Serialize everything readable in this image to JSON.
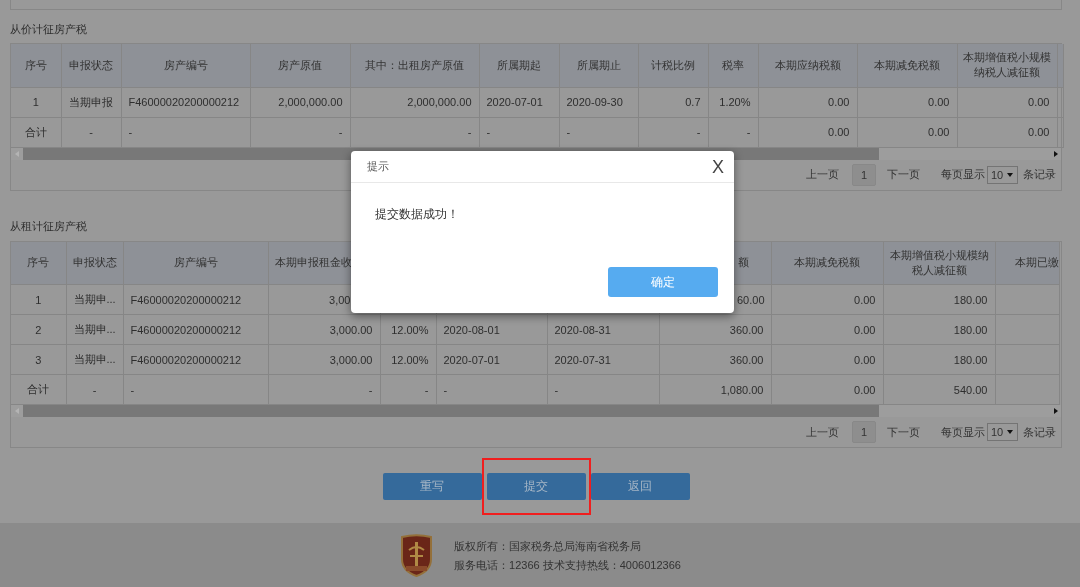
{
  "sections": [
    {
      "title": "从价计征房产税",
      "table": {
        "columns": [
          "序号",
          "申报状态",
          "房产编号",
          "房产原值",
          "其中：出租房产原值",
          "所属期起",
          "所属期止",
          "计税比例",
          "税率",
          "本期应纳税额",
          "本期减免税额",
          "本期增值税小规模纳税人减征额"
        ],
        "rows": [
          [
            "1",
            "当期申报",
            "F46000020200000212",
            "2,000,000.00",
            "2,000,000.00",
            "2020-07-01",
            "2020-09-30",
            "0.7",
            "1.20%",
            "0.00",
            "0.00",
            "0.00"
          ],
          [
            "合计",
            "-",
            "-",
            "-",
            "-",
            "-",
            "-",
            "-",
            "-",
            "0.00",
            "0.00",
            "0.00"
          ]
        ]
      },
      "pagination": {
        "prev": "上一页",
        "page": "1",
        "next": "下一页",
        "size_label": "每页显示",
        "size": "10",
        "size_suffix": "条记录"
      }
    },
    {
      "title": "从租计征房产税",
      "table": {
        "columns": [
          "序号",
          "申报状态",
          "房产编号",
          "本期申报租金收",
          null,
          null,
          null,
          "额",
          "本期减免税额",
          "本期增值税小规模纳税人减征额",
          "本期已缴"
        ],
        "rows": [
          [
            "1",
            "当期申...",
            "F46000020200000212",
            "3,00",
            null,
            null,
            null,
            "60.00",
            "0.00",
            "180.00"
          ],
          [
            "2",
            "当期申...",
            "F46000020200000212",
            "3,000.00",
            "12.00%",
            "2020-08-01",
            "2020-08-31",
            "360.00",
            "0.00",
            "180.00"
          ],
          [
            "3",
            "当期申...",
            "F46000020200000212",
            "3,000.00",
            "12.00%",
            "2020-07-01",
            "2020-07-31",
            "360.00",
            "0.00",
            "180.00"
          ],
          [
            "合计",
            "-",
            "-",
            "-",
            "-",
            "-",
            "-",
            "1,080.00",
            "0.00",
            "540.00"
          ]
        ]
      },
      "pagination": {
        "prev": "上一页",
        "page": "1",
        "next": "下一页",
        "size_label": "每页显示",
        "size": "10",
        "size_suffix": "条记录"
      }
    }
  ],
  "buttons": [
    {
      "label": "重写",
      "highlighted": false
    },
    {
      "label": "提交",
      "highlighted": true
    },
    {
      "label": "返回",
      "highlighted": false
    }
  ],
  "footer": {
    "lines": [
      "版权所有：国家税务总局海南省税务局",
      "服务电话：12366 技术支持热线：4006012366"
    ]
  },
  "dialog": {
    "title": "提示",
    "close": "X",
    "message": "提交数据成功！",
    "confirm": "确定"
  }
}
